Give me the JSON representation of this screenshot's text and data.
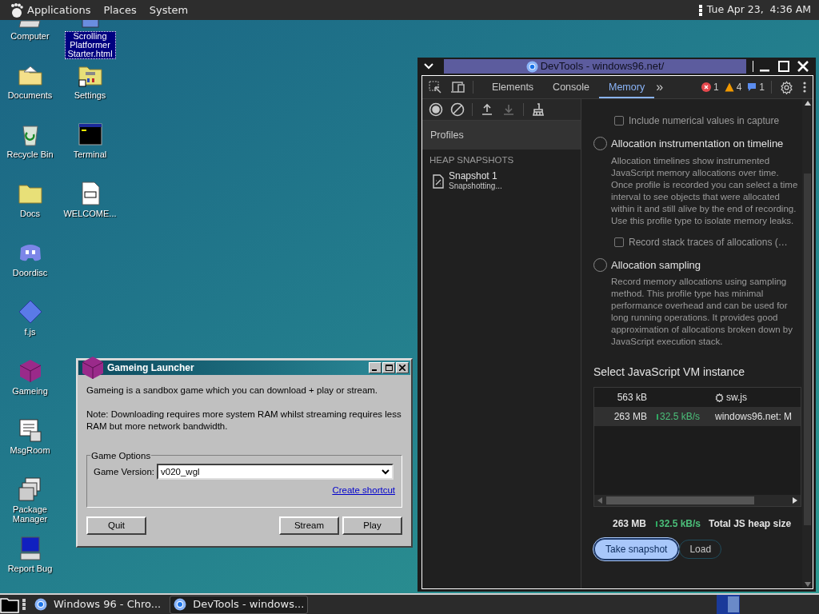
{
  "top_bar": {
    "menus": [
      "Applications",
      "Places",
      "System"
    ],
    "clock": "Tue Apr 23,  4:36 AM"
  },
  "desktop": {
    "columns": [
      {
        "icons": [
          {
            "label": "Computer",
            "kind": "computer",
            "selected": false
          },
          {
            "label": "Documents",
            "kind": "documents",
            "selected": false
          },
          {
            "label": "Recycle Bin",
            "kind": "recycle",
            "selected": false
          },
          {
            "label": "Docs",
            "kind": "folder",
            "selected": false
          },
          {
            "label": "Doordisc",
            "kind": "chat",
            "selected": false
          },
          {
            "label": "f.js",
            "kind": "diamond",
            "selected": false
          },
          {
            "label": "Gameing",
            "kind": "cube",
            "selected": false
          },
          {
            "label": "MsgRoom",
            "kind": "messenger",
            "selected": false
          },
          {
            "label": "Package Manager",
            "kind": "package",
            "selected": false
          },
          {
            "label": "Report Bug",
            "kind": "monitor",
            "selected": false
          }
        ]
      },
      {
        "icons": [
          {
            "label": "Scrolling Platformer Starter.html",
            "kind": "webpage",
            "selected": true
          },
          {
            "label": "Settings",
            "kind": "settings",
            "selected": false
          },
          {
            "label": "Terminal",
            "kind": "terminal",
            "selected": false
          },
          {
            "label": "WELCOME...",
            "kind": "markdown",
            "selected": false
          }
        ]
      }
    ]
  },
  "launcher": {
    "title": "Gameing Launcher",
    "intro": "Gameing is a sandbox game which you can download + play or stream.",
    "note": "Note: Downloading requires more system RAM whilst streaming requires less RAM but more network bandwidth.",
    "group_title": "Game Options",
    "version_label": "Game Version:",
    "version_value": "v020_wgl",
    "shortcut_link": "Create shortcut",
    "buttons": [
      "Quit",
      "Stream",
      "Play"
    ]
  },
  "devtools": {
    "title": "DevTools - windows96.net/",
    "tabs": [
      {
        "label": "Elements",
        "selected": false
      },
      {
        "label": "Console",
        "selected": false
      },
      {
        "label": "Memory",
        "selected": true
      }
    ],
    "more_tabs": "»",
    "issue_counts": [
      {
        "kind": "error",
        "count": "1"
      },
      {
        "kind": "warning",
        "count": "4"
      },
      {
        "kind": "info",
        "count": "1"
      }
    ],
    "tools": [
      {
        "kind": "record",
        "disabled": false
      },
      {
        "kind": "clear",
        "disabled": false
      },
      {
        "kind": "upload",
        "disabled": false
      },
      {
        "kind": "download",
        "disabled": true
      },
      {
        "kind": "broom",
        "disabled": false
      }
    ],
    "profiles_header": "Profiles",
    "section": "HEAP SNAPSHOTS",
    "snapshot": {
      "title": "Snapshot 1",
      "status": "Snapshotting..."
    },
    "options": [
      {
        "kind": "checkbox",
        "label": "Include numerical values in capture",
        "checked": false
      },
      {
        "kind": "radio",
        "label": "Allocation instrumentation on timeline",
        "selected": false,
        "description": "Allocation timelines show instrumented JavaScript memory allocations over time. Once profile is recorded you can select a time interval to see objects that were allocated within it and still alive by the end of recording. Use this profile type to isolate memory leaks."
      },
      {
        "kind": "checkbox",
        "label": "Record stack traces of allocations (…",
        "checked": false
      },
      {
        "kind": "radio",
        "label": "Allocation sampling",
        "selected": false,
        "description": "Record memory allocations using sampling method. This profile type has minimal performance overhead and can be used for long running operations. It provides good approximation of allocations broken down by JavaScript execution stack."
      }
    ],
    "vm_heading": "Select JavaScript VM instance",
    "vm_rows": [
      {
        "size": "563 kB",
        "rate": "",
        "name": "sw.js",
        "kind": "worker",
        "selected": false
      },
      {
        "size": "263 MB",
        "rate": "32.5 kB/s",
        "name": "windows96.net: M",
        "kind": "page",
        "selected": true
      }
    ],
    "totals": {
      "size": "263 MB",
      "rate": "32.5 kB/s",
      "label": "Total JS heap size"
    },
    "actions": [
      {
        "label": "Take snapshot",
        "kind": "primary"
      },
      {
        "label": "Load",
        "kind": "secondary"
      }
    ]
  },
  "taskbar": {
    "tasks": [
      {
        "label": "Windows 96 - Chro...",
        "selected": false
      },
      {
        "label": "DevTools - windows...",
        "selected": true
      }
    ]
  }
}
